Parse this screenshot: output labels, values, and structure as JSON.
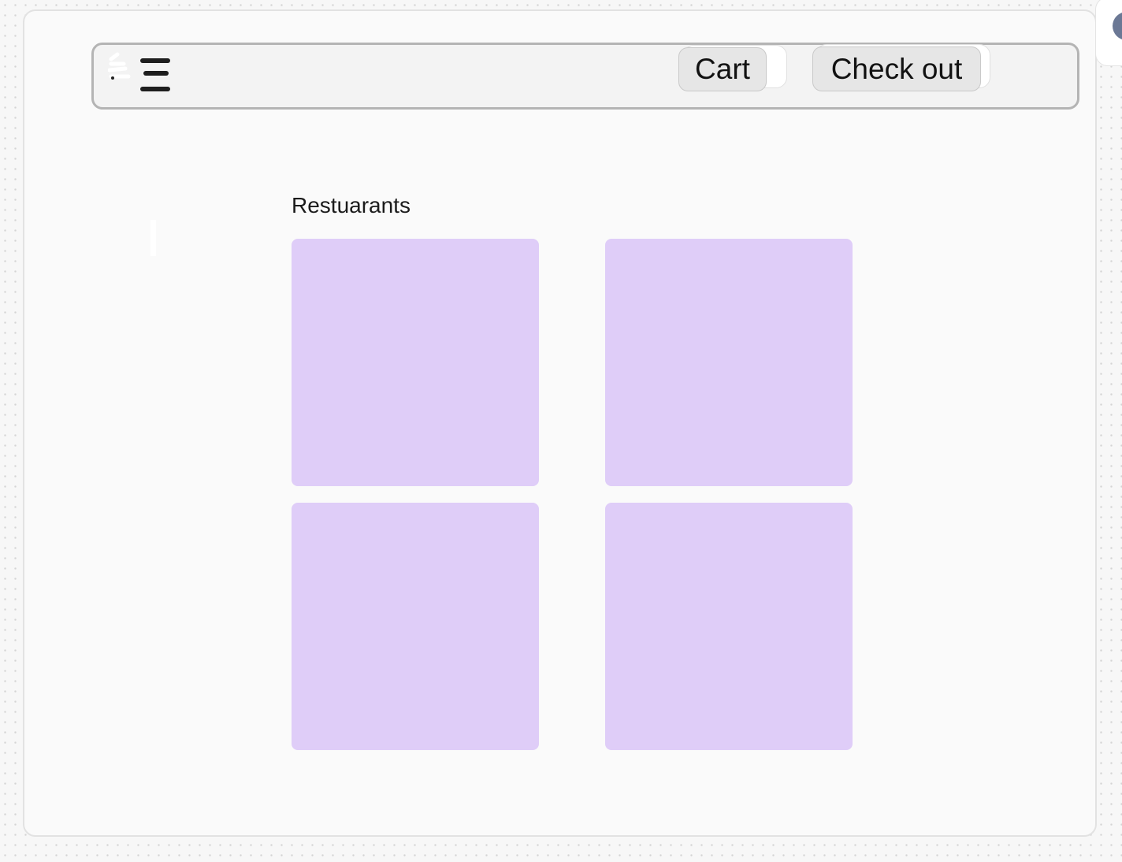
{
  "navbar": {
    "menu_icon": "hamburger-menu-icon",
    "cart_label": "Cart",
    "checkout_label": "Check out"
  },
  "main": {
    "section_title": "Restuarants",
    "restaurant_cards": [
      {
        "label": ""
      },
      {
        "label": ""
      },
      {
        "label": ""
      },
      {
        "label": ""
      }
    ]
  },
  "colors": {
    "card_fill": "#dfcdf8",
    "navbar_background": "#f3f3f3",
    "navbar_border": "#b4b4b4",
    "button_background": "#e6e6e6",
    "avatar": "#6b7895"
  }
}
